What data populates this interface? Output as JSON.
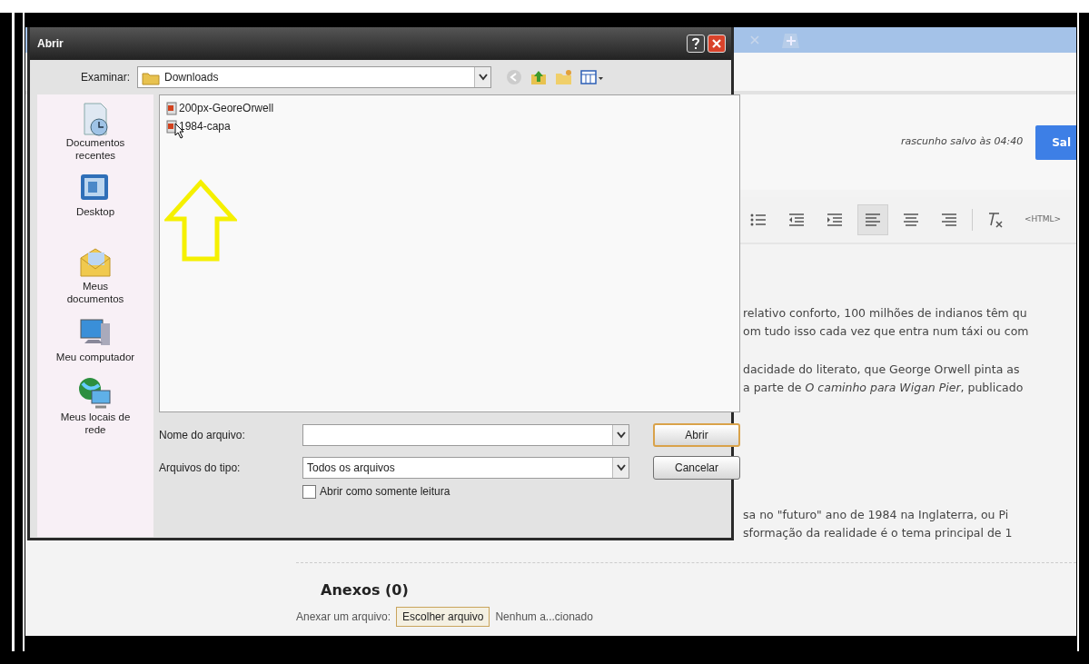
{
  "dialog": {
    "title": "Abrir",
    "look_in_label": "Examinar:",
    "look_in_value": "Downloads",
    "places": [
      {
        "label": "Documentos recentes",
        "kind": "recent"
      },
      {
        "label": "Desktop",
        "kind": "desktop"
      },
      {
        "label": "Meus documentos",
        "kind": "documents"
      },
      {
        "label": "Meu computador",
        "kind": "computer"
      },
      {
        "label": "Meus locais de rede",
        "kind": "network"
      }
    ],
    "files": [
      {
        "name": "200px-GeoreOrwell",
        "selected": false
      },
      {
        "name": "1984-capa",
        "selected": false
      }
    ],
    "filename_label": "Nome do arquivo:",
    "filetype_label": "Arquivos do tipo:",
    "filetype_value": "Todos os arquivos",
    "readonly": {
      "label": "Abrir como somente leitura",
      "checked": false
    },
    "buttons": [
      {
        "label": "Abrir",
        "default": true
      },
      {
        "label": "Cancelar",
        "default": false
      }
    ]
  },
  "editor": {
    "draft_status": "rascunho salvo às 04:40",
    "save_button": "Sal",
    "toolbar": [
      {
        "kind": "bullets",
        "active": false
      },
      {
        "kind": "outdent",
        "active": false
      },
      {
        "kind": "indent",
        "active": false
      },
      {
        "kind": "align-left",
        "active": true
      },
      {
        "kind": "align-center",
        "active": false
      },
      {
        "kind": "align-right",
        "active": false
      },
      {
        "kind": "clear-format",
        "active": false
      },
      {
        "kind": "html",
        "label": "<HTML>",
        "active": false
      }
    ],
    "paragraphs": [
      [
        "relativo conforto, 100 milhões de indianos têm qu",
        "om tudo isso cada vez que entra num táxi ou com"
      ],
      [
        "dacidade do literato, que George Orwell pinta as",
        "a parte de *O caminho para Wigan Pier*, publicado"
      ],
      [
        "sa no \"futuro\" ano de 1984 na Inglaterra, ou Pi",
        "sformação da realidade é o tema principal de 1"
      ]
    ],
    "attachments": {
      "heading": "Anexos (0)",
      "label": "Anexar um arquivo:",
      "button": "Escolher arquivo",
      "status": "Nenhum a...cionado"
    }
  }
}
